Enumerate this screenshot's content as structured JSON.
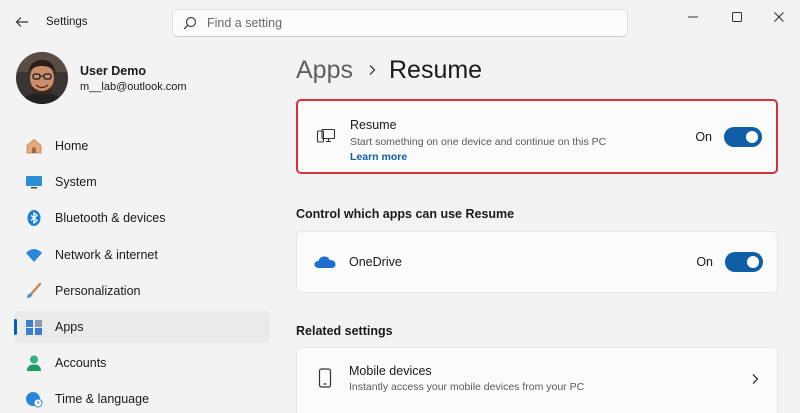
{
  "titlebar": {
    "app_title": "Settings",
    "search_placeholder": "Find a setting"
  },
  "profile": {
    "name": "User Demo",
    "email": "m__lab@outlook.com"
  },
  "nav": {
    "items": [
      {
        "label": "Home",
        "icon": "home-icon",
        "active": false
      },
      {
        "label": "System",
        "icon": "monitor-icon",
        "active": false
      },
      {
        "label": "Bluetooth & devices",
        "icon": "bluetooth-icon",
        "active": false
      },
      {
        "label": "Network & internet",
        "icon": "wifi-icon",
        "active": false
      },
      {
        "label": "Personalization",
        "icon": "brush-icon",
        "active": false
      },
      {
        "label": "Apps",
        "icon": "apps-icon",
        "active": true
      },
      {
        "label": "Accounts",
        "icon": "person-icon",
        "active": false
      },
      {
        "label": "Time & language",
        "icon": "globe-clock-icon",
        "active": false
      }
    ]
  },
  "breadcrumb": {
    "parent": "Apps",
    "current": "Resume"
  },
  "resume_card": {
    "title": "Resume",
    "description": "Start something on one device and continue on this PC",
    "link": "Learn more",
    "toggle_label": "On",
    "toggle_on": true
  },
  "apps_section": {
    "heading": "Control which apps can use Resume",
    "onedrive": {
      "name": "OneDrive",
      "toggle_label": "On",
      "toggle_on": true
    }
  },
  "related": {
    "heading": "Related settings",
    "mobile": {
      "title": "Mobile devices",
      "description": "Instantly access your mobile devices from your PC"
    }
  },
  "colors": {
    "accent": "#0f5ea8",
    "highlight_border": "#d1343b",
    "background": "#f3f3f3",
    "card": "#fbfbfb"
  }
}
